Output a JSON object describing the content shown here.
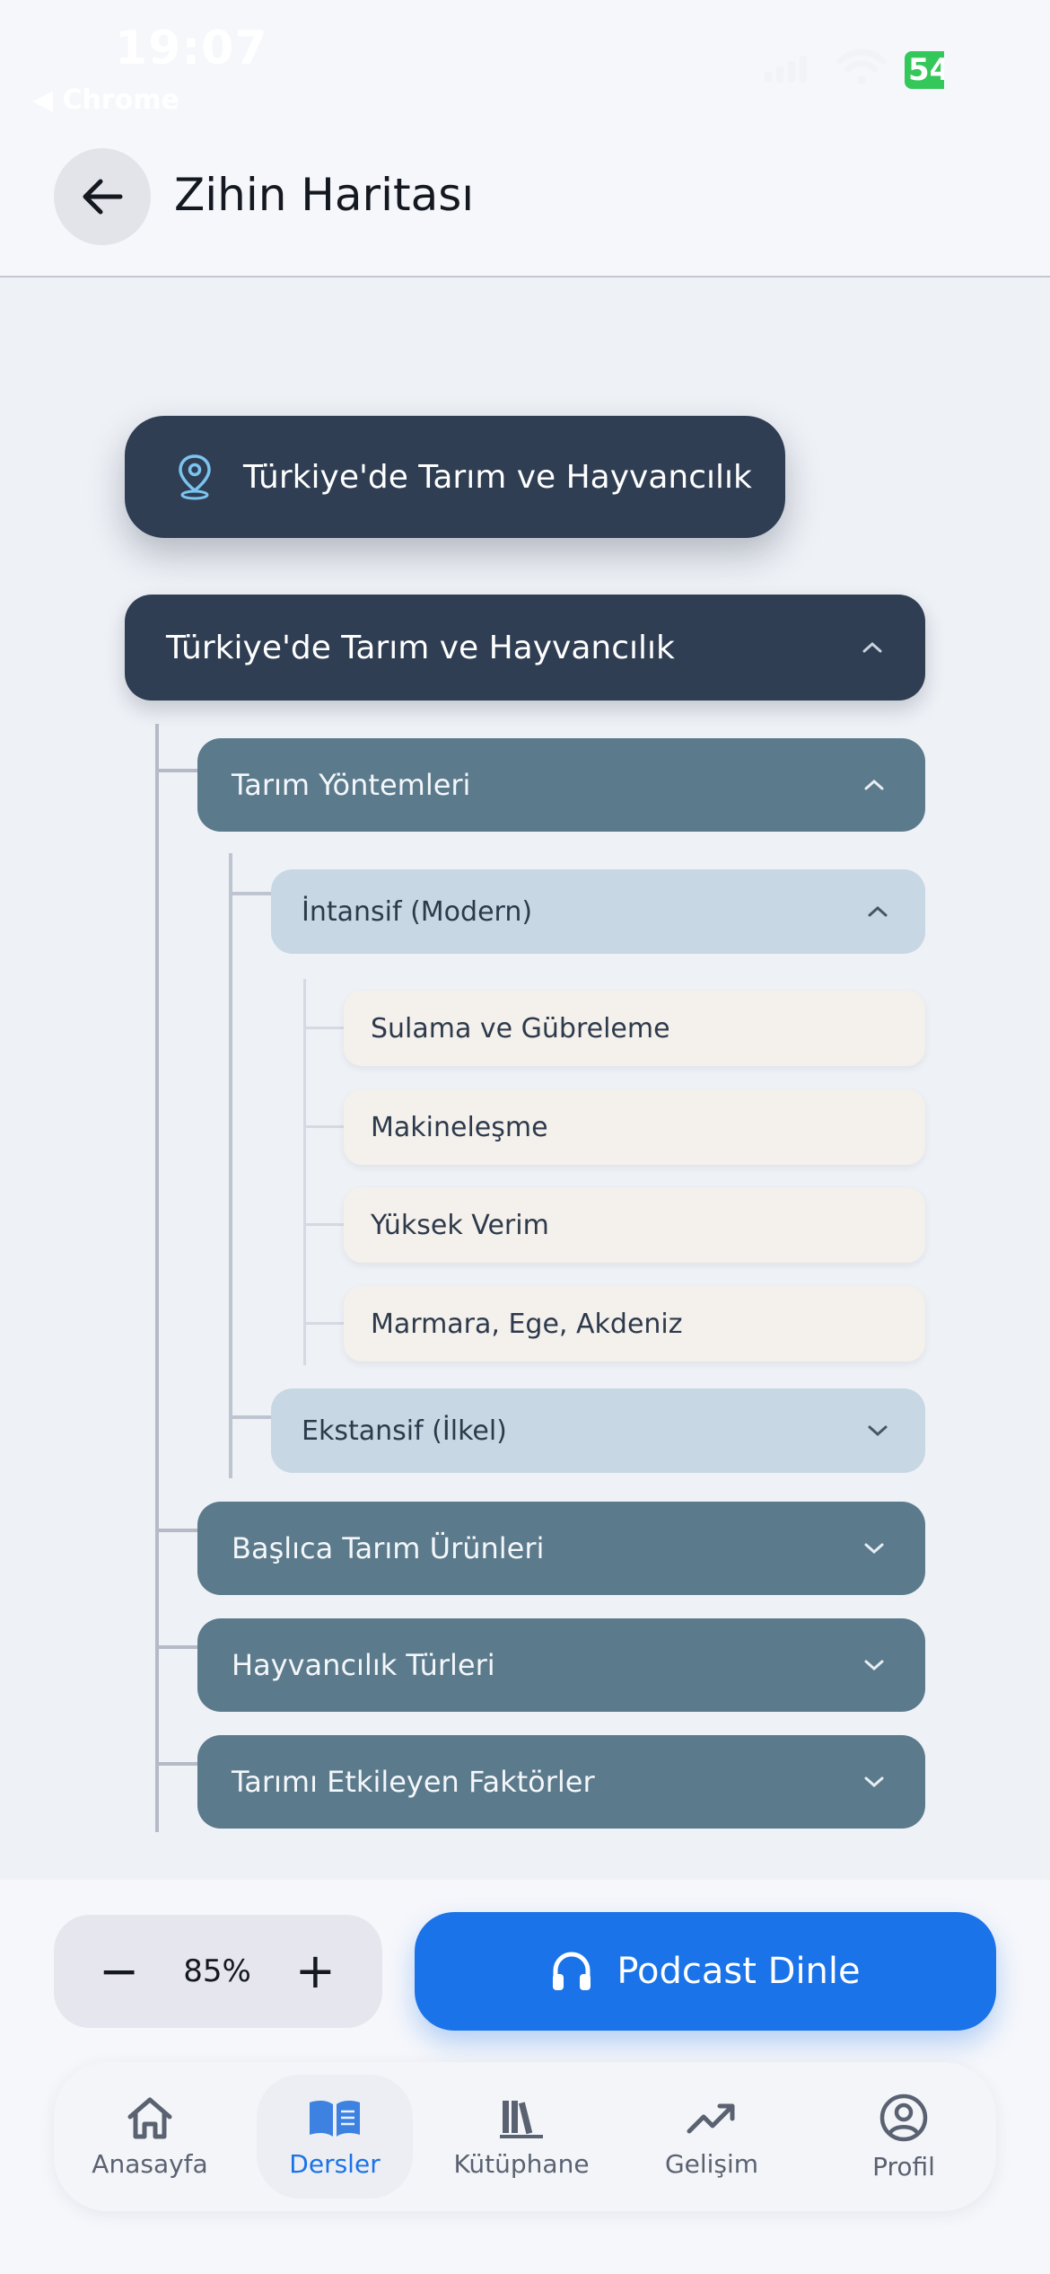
{
  "status_bar": {
    "time": "19:07",
    "back_app": "◀ Chrome",
    "battery": "54"
  },
  "header": {
    "title": "Zihin Haritası"
  },
  "mind_map": {
    "root_pill": "Türkiye'de Tarım ve Hayvancılık",
    "root_node": "Türkiye'de Tarım ve Hayvancılık",
    "level1": [
      "Tarım Yöntemleri",
      "Başlıca Tarım Ürünleri",
      "Hayvancılık Türleri",
      "Tarımı Etkileyen Faktörler"
    ],
    "level2": [
      "İntansif (Modern)",
      "Ekstansif (İlkel)"
    ],
    "level3": [
      "Sulama ve Gübreleme",
      "Makineleşme",
      "Yüksek Verim",
      "Marmara, Ege, Akdeniz"
    ]
  },
  "controls": {
    "zoom_minus": "−",
    "zoom_value": "85%",
    "zoom_plus": "+",
    "podcast_label": "Podcast Dinle"
  },
  "tabbar": {
    "items": [
      {
        "label": "Anasayfa",
        "icon": "home-icon"
      },
      {
        "label": "Dersler",
        "icon": "open-book-icon",
        "active": true
      },
      {
        "label": "Kütüphane",
        "icon": "books-icon"
      },
      {
        "label": "Gelişim",
        "icon": "trending-up-icon"
      },
      {
        "label": "Profil",
        "icon": "user-circle-icon"
      }
    ]
  },
  "colors": {
    "accent": "#1a73e8",
    "dark_node": "#2f3e53",
    "level1_node": "#5b7a8c",
    "level2_node": "#c7d7e3",
    "leaf_node": "#f4f0ec"
  }
}
